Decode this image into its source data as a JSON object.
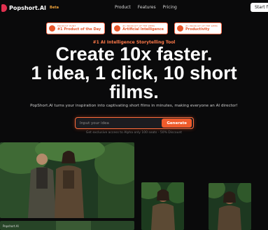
{
  "header": {
    "brand": "Popshort.AI",
    "beta": "Beta",
    "nav": [
      "Product",
      "Features",
      "Pricing"
    ],
    "start_label": "Start for free"
  },
  "badges": [
    {
      "top": "PRODUCT HUNT",
      "main": "#1 Product of the Day"
    },
    {
      "top": "#1 PRODUCT OF THE WEEK",
      "main": "Artificial Intelligence"
    },
    {
      "top": "#1 PRODUCT OF THE WEEK",
      "main": "Productivity"
    }
  ],
  "hero": {
    "tagline": "#1 AI Intelligence Storytelling Tool",
    "line1": "Create 10x faster.",
    "line2": "1 idea, 1 click, 10 short",
    "line3": "films.",
    "subtitle": "PopShort.AI turns your inspiration into captivating short films in minutes, making everyone an AI director!"
  },
  "search": {
    "placeholder": "Input your idea",
    "button": "Generate",
    "note": "Get exclusive access to Alpha only 100 seats - 50% Discount"
  },
  "gallery": {
    "watermark": "Popshort.AI"
  }
}
